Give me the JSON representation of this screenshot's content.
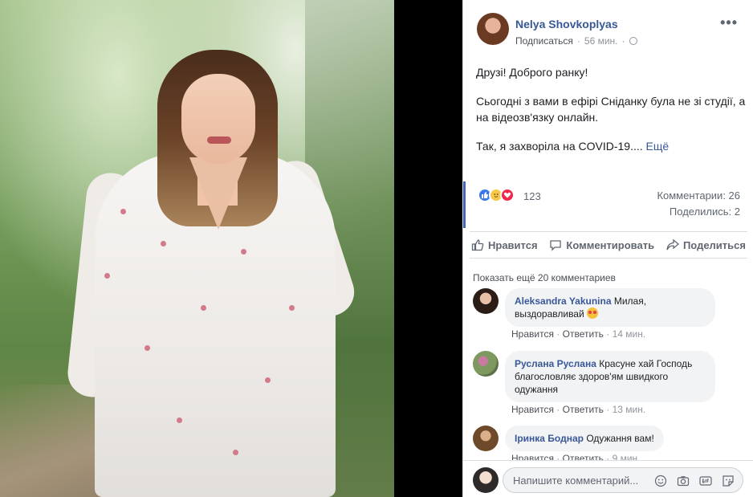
{
  "post": {
    "author": "Nelya Shovkoplyas",
    "subscribe_label": "Подписаться",
    "separator": "·",
    "time": "56 мин.",
    "more": "•••",
    "text_lines": [
      "Друзі! Доброго ранку!",
      "Сьогодні з вами в ефірі Сніданку була не зі студії, а на відеозв'язку онлайн.",
      "Так, я захворіла на COVID-19...."
    ],
    "see_more": "Ещё"
  },
  "reactions": {
    "count": "123",
    "comments": "Комментарии: 26",
    "shares": "Поделились: 2",
    "icons": [
      "like-reaction-icon",
      "care-reaction-icon",
      "love-reaction-icon"
    ]
  },
  "actions": {
    "like": "Нравится",
    "comment": "Комментировать",
    "share": "Поделиться"
  },
  "comments_section": {
    "show_more": "Показать ещё 20 комментариев",
    "items": [
      {
        "name": "Aleksandra Yakunina",
        "text": "Милая, выздоравливай",
        "like": "Нравится",
        "reply": "Ответить",
        "time": "14 мин."
      },
      {
        "name": "Руслана Руслана",
        "text": "Красуне хай Господь благословляє здоров'ям швидкого одужання",
        "like": "Нравится",
        "reply": "Ответить",
        "time": "13 мин."
      },
      {
        "name": "Іринка Боднар",
        "text": "Одужання вам!",
        "like": "Нравится",
        "reply": "Ответить",
        "time": "9 мин."
      }
    ]
  },
  "composer": {
    "placeholder": "Напишите комментарий...",
    "tools": [
      "emoji-icon",
      "camera-icon",
      "gif-icon",
      "sticker-icon"
    ]
  },
  "colors": {
    "link_blue": "#385898",
    "accent_blue": "#4267b2",
    "text_gray": "#606770"
  }
}
